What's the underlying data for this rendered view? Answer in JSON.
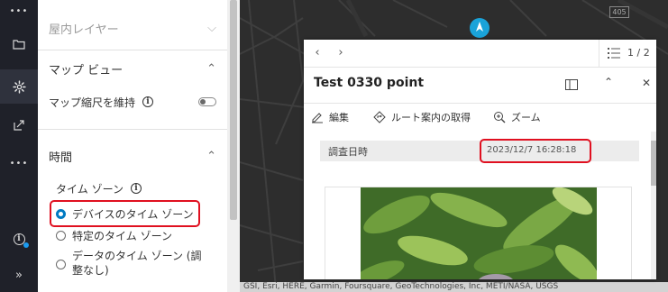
{
  "rail": {
    "top_more": "•••",
    "mid_more": "•••",
    "collapse": "»"
  },
  "panel": {
    "indoor_layer": "屋内レイヤー",
    "map_view": {
      "title": "マップ ビュー",
      "keep_scale_label": "マップ縮尺を維持",
      "keep_scale_on": false
    },
    "time": {
      "title": "時間",
      "time_zone_label": "タイム ゾーン",
      "options": [
        {
          "label": "デバイスのタイム ゾーン",
          "selected": true
        },
        {
          "label": "特定のタイム ゾーン",
          "selected": false
        },
        {
          "label": "データのタイム ゾーン (調",
          "selected": false
        }
      ],
      "option3_line2": "整なし)"
    }
  },
  "map": {
    "road_badge": "405",
    "attribution": "GSI, Esri, HERE, Garmin, Foursquare, GeoTechnologies, Inc, METI/NASA, USGS"
  },
  "popup": {
    "pager": "1 / 2",
    "title": "Test 0330 point",
    "actions": {
      "edit": "編集",
      "directions": "ルート案内の取得",
      "zoom": "ズーム"
    },
    "field_label": "調査日時",
    "field_value": "2023/12/7 16:28:18"
  },
  "colors": {
    "accent": "#007ac2",
    "highlight": "#e01020",
    "rail_bg": "#1f2129"
  }
}
